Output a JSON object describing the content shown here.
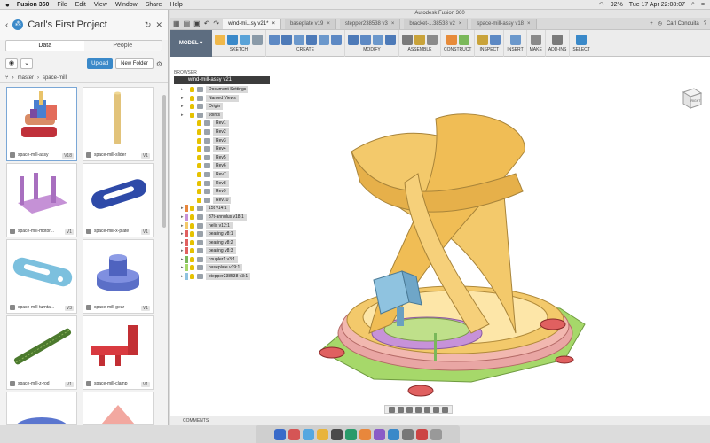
{
  "menubar": {
    "apple": "",
    "items": [
      "Fusion 360",
      "File",
      "Edit",
      "View",
      "Window",
      "Share",
      "Help"
    ],
    "battery": "92%",
    "clock": "Tue 17 Apr  22:08:07"
  },
  "datapanel": {
    "title": "Carl's First Project",
    "tabs": [
      "Data",
      "People"
    ],
    "upload_label": "Upload",
    "new_folder_label": "New Folder",
    "breadcrumb": [
      "master",
      "space-mill"
    ],
    "items": [
      {
        "name": "space-mill-assy",
        "version": "V18"
      },
      {
        "name": "space-mill-slider",
        "version": "V1"
      },
      {
        "name": "space-mill-motor...",
        "version": "V1"
      },
      {
        "name": "space-mill-x-plate",
        "version": "V1"
      },
      {
        "name": "space-mill-turnta...",
        "version": "V3"
      },
      {
        "name": "space-mill-gear",
        "version": "V1"
      },
      {
        "name": "space-mill-z-rod",
        "version": "V1"
      },
      {
        "name": "space-mill-clamp",
        "version": "V1"
      }
    ]
  },
  "main": {
    "window_title": "Autodesk Fusion 360",
    "user": "Carl Conquita",
    "doc_tabs": [
      {
        "label": "wind-mi...sy v21*",
        "active": true
      },
      {
        "label": "baseplate v19",
        "active": false
      },
      {
        "label": "stepper238538 v3",
        "active": false
      },
      {
        "label": "bracket-...38538 v2",
        "active": false
      },
      {
        "label": "space-mill-assy v18",
        "active": false
      }
    ],
    "workspace": "MODEL",
    "toolbar_groups": [
      "SKETCH",
      "CREATE",
      "MODIFY",
      "ASSEMBLE",
      "CONSTRUCT",
      "INSPECT",
      "INSERT",
      "MAKE",
      "ADD-INS",
      "SELECT"
    ],
    "browser_label": "BROWSER",
    "root": "wind-mill-assy v21",
    "nodes": [
      {
        "label": "Document Settings",
        "level": 1
      },
      {
        "label": "Named Views",
        "level": 1
      },
      {
        "label": "Origin",
        "level": 1
      },
      {
        "label": "Joints",
        "level": 1
      },
      {
        "label": "Rev1",
        "level": 2
      },
      {
        "label": "Rev2",
        "level": 2
      },
      {
        "label": "Rev3",
        "level": 2
      },
      {
        "label": "Rev4",
        "level": 2
      },
      {
        "label": "Rev5",
        "level": 2
      },
      {
        "label": "Rev6",
        "level": 2
      },
      {
        "label": "Rev7",
        "level": 2
      },
      {
        "label": "Rev8",
        "level": 2
      },
      {
        "label": "Rev9",
        "level": 2
      },
      {
        "label": "Rev10",
        "level": 2
      },
      {
        "label": "15t v14:1",
        "level": 1
      },
      {
        "label": "37t-annulus v18:1",
        "level": 1
      },
      {
        "label": "helix v12:1",
        "level": 1
      },
      {
        "label": "bearing v8:1",
        "level": 1
      },
      {
        "label": "bearing v8:2",
        "level": 1
      },
      {
        "label": "bearing v8:3",
        "level": 1
      },
      {
        "label": "coupler1 v3:1",
        "level": 1
      },
      {
        "label": "baseplate v19:1",
        "level": 1
      },
      {
        "label": "stepper238538 v3:1",
        "level": 1
      }
    ],
    "comments_label": "COMMENTS",
    "viewcube_label": "RIGHT"
  },
  "colors": {
    "accent": "#3a89c9",
    "model_btn": "#5d6d80",
    "blade": "#f3c96b",
    "base_green": "#a6d86a",
    "ring_pink": "#e9a6a4",
    "motor_blue": "#8fc3e0"
  }
}
